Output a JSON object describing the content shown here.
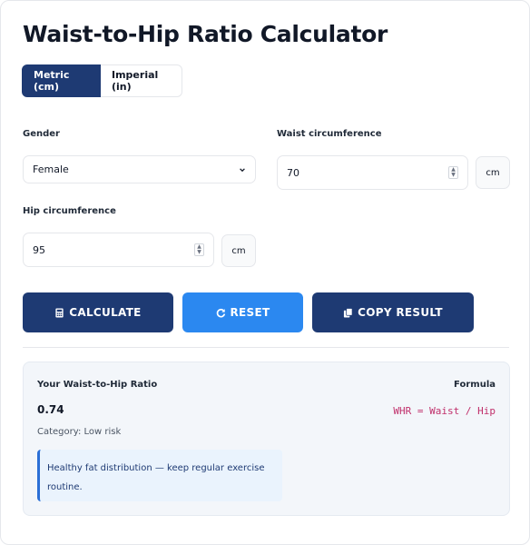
{
  "header": {
    "title": "Waist-to-Hip Ratio Calculator"
  },
  "units": {
    "metric": "Metric (cm)",
    "imperial": "Imperial (in)",
    "selected": "metric"
  },
  "form": {
    "gender_label": "Gender",
    "gender_value": "Female",
    "waist_label": "Waist circumference",
    "waist_value": "70",
    "waist_unit": "cm",
    "hip_label": "Hip circumference",
    "hip_value": "95",
    "hip_unit": "cm"
  },
  "buttons": {
    "calculate": "CALCULATE",
    "reset": "RESET",
    "copy": "COPY RESULT"
  },
  "result": {
    "heading": "Your Waist-to-Hip Ratio",
    "value": "0.74",
    "category": "Category: Low risk",
    "formula_label": "Formula",
    "formula": "WHR = Waist / Hip",
    "note": "Healthy fat distribution — keep regular exercise routine."
  },
  "colors": {
    "primary": "#1e3a73",
    "accent": "#2b88f0",
    "formula": "#c0306b"
  }
}
